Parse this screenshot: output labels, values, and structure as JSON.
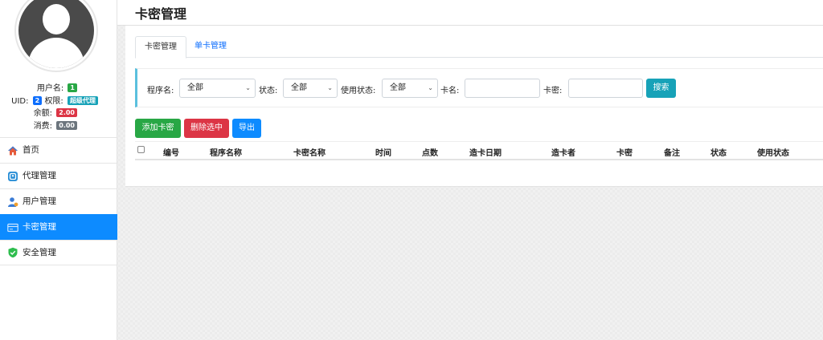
{
  "page_title": "卡密管理",
  "user": {
    "username_label": "用户名:",
    "username_value": "1",
    "uid_label": "UID:",
    "uid_value": "2",
    "role_label": "权限:",
    "role_value": "超级代理",
    "balance_label": "余额:",
    "balance_value": "2.00",
    "spent_label": "消费:",
    "spent_value": "0.00"
  },
  "sidebar": {
    "items": [
      {
        "label": "首页",
        "icon": "home-icon"
      },
      {
        "label": "代理管理",
        "icon": "agent-icon"
      },
      {
        "label": "用户管理",
        "icon": "user-icon"
      },
      {
        "label": "卡密管理",
        "icon": "card-icon",
        "active": true
      },
      {
        "label": "安全管理",
        "icon": "shield-icon"
      }
    ]
  },
  "tabs": [
    {
      "label": "卡密管理",
      "active": true
    },
    {
      "label": "单卡管理",
      "active": false
    }
  ],
  "filter": {
    "program_label": "程序名:",
    "program_value": "全部",
    "status_label": "状态:",
    "status_value": "全部",
    "use_status_label": "使用状态:",
    "use_status_value": "全部",
    "card_name_label": "卡名:",
    "card_name_value": "",
    "card_key_label": "卡密:",
    "card_key_value": "",
    "search_label": "搜索"
  },
  "actions": {
    "add_label": "添加卡密",
    "delete_label": "删除选中",
    "export_label": "导出"
  },
  "table": {
    "columns": [
      "编号",
      "程序名称",
      "卡密名称",
      "时间",
      "点数",
      "造卡日期",
      "造卡者",
      "卡密",
      "备注",
      "状态",
      "使用状态"
    ],
    "rows": []
  },
  "colors": {
    "accent": "#0d8bff",
    "add": "#28a745",
    "delete": "#dc3545",
    "search": "#17a2b8"
  }
}
